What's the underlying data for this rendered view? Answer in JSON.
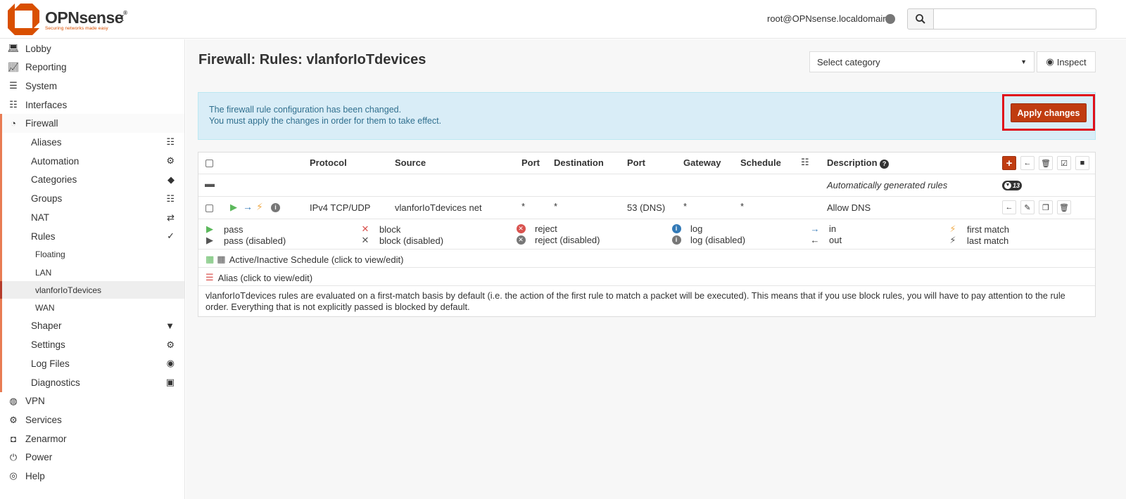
{
  "brand": {
    "name": "OPNsense",
    "reg": "®",
    "tagline": "Securing networks made easy"
  },
  "header": {
    "user": "root@OPNsense.localdomain",
    "search_placeholder": ""
  },
  "sidebar": {
    "top": [
      {
        "label": "Lobby",
        "icon": "laptop-icon"
      },
      {
        "label": "Reporting",
        "icon": "area-chart-icon"
      },
      {
        "label": "System",
        "icon": "server-icon"
      },
      {
        "label": "Interfaces",
        "icon": "sitemap-icon"
      },
      {
        "label": "Firewall",
        "icon": "fire-icon"
      }
    ],
    "firewall_items": [
      {
        "label": "Aliases",
        "icon": "list-icon"
      },
      {
        "label": "Automation",
        "icon": "gear-icon"
      },
      {
        "label": "Categories",
        "icon": "tags-icon"
      },
      {
        "label": "Groups",
        "icon": "sitemap-icon"
      },
      {
        "label": "NAT",
        "icon": "exchange-icon"
      },
      {
        "label": "Rules",
        "icon": "check-icon"
      }
    ],
    "rules_items": [
      {
        "label": "Floating"
      },
      {
        "label": "LAN"
      },
      {
        "label": "vlanforIoTdevices"
      },
      {
        "label": "WAN"
      }
    ],
    "firewall_items2": [
      {
        "label": "Shaper",
        "icon": "filter-icon"
      },
      {
        "label": "Settings",
        "icon": "cogs-icon"
      },
      {
        "label": "Log Files",
        "icon": "eye-icon"
      },
      {
        "label": "Diagnostics",
        "icon": "medkit-icon"
      }
    ],
    "bottom": [
      {
        "label": "VPN",
        "icon": "globe-icon"
      },
      {
        "label": "Services",
        "icon": "gear-icon"
      },
      {
        "label": "Zenarmor",
        "icon": "binoculars-icon"
      },
      {
        "label": "Power",
        "icon": "plug-icon"
      },
      {
        "label": "Help",
        "icon": "life-ring-icon"
      }
    ]
  },
  "page": {
    "title": "Firewall: Rules: vlanforIoTdevices",
    "category_placeholder": "Select category",
    "inspect_label": "Inspect"
  },
  "alert": {
    "line1": "The firewall rule configuration has been changed.",
    "line2": "You must apply the changes in order for them to take effect.",
    "apply_label": "Apply changes"
  },
  "table": {
    "headers": {
      "protocol": "Protocol",
      "source": "Source",
      "port": "Port",
      "destination": "Destination",
      "dport": "Port",
      "gateway": "Gateway",
      "schedule": "Schedule",
      "description": "Description"
    },
    "auto_row": {
      "description": "Automatically generated rules",
      "count": "13"
    },
    "rule": {
      "protocol": "IPv4 TCP/UDP",
      "source": "vlanforIoTdevices net",
      "sport": "*",
      "destination": "*",
      "dport": "53 (DNS)",
      "gateway": "*",
      "schedule": "*",
      "description": "Allow DNS"
    }
  },
  "legend": {
    "pass": "pass",
    "pass_disabled": "pass (disabled)",
    "block": "block",
    "block_disabled": "block (disabled)",
    "reject": "reject",
    "reject_disabled": "reject (disabled)",
    "log": "log",
    "log_disabled": "log (disabled)",
    "in": "in",
    "out": "out",
    "first_match": "first match",
    "last_match": "last match",
    "schedule": "Active/Inactive Schedule (click to view/edit)",
    "alias": "Alias (click to view/edit)"
  },
  "footer_note": "vlanforIoTdevices rules are evaluated on a first-match basis by default (i.e. the action of the first rule to match a packet will be executed). This means that if you use block rules, you will have to pay attention to the rule order. Everything that is not explicitly passed is blocked by default.",
  "colors": {
    "accent": "#c03c10",
    "pass": "#5cb85c",
    "block": "#d9534f",
    "info": "#337ab7",
    "lightning": "#f0ad4e"
  }
}
